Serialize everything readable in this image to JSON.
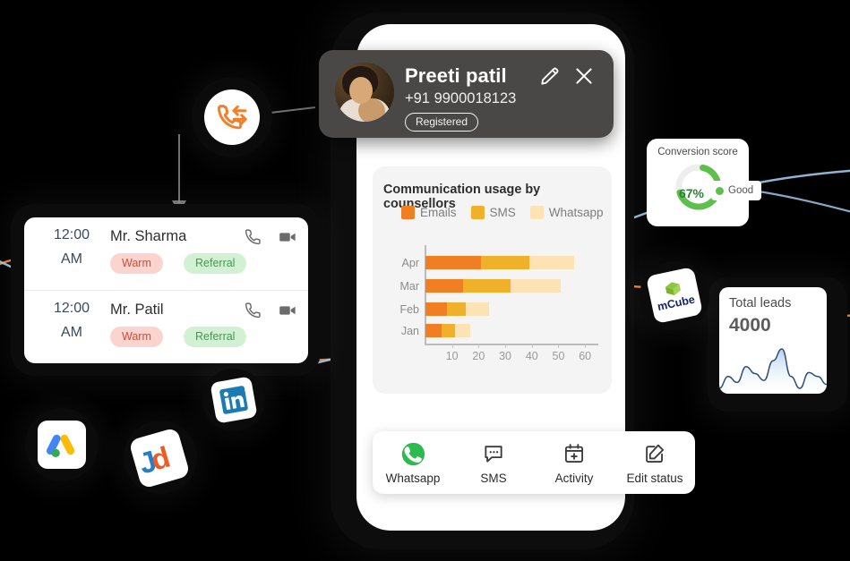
{
  "contact": {
    "name": "Preeti patil",
    "phone": "+91 9900018123",
    "status_badge": "Registered",
    "edit_icon": "pencil-icon",
    "close_icon": "close-icon",
    "avatar": "contact-avatar"
  },
  "chart_card": {
    "title": "Communication usage by counsellors"
  },
  "chart_data": {
    "type": "bar",
    "orientation": "horizontal",
    "stacked": true,
    "title": "Communication usage by counsellors",
    "categories": [
      "Apr",
      "Mar",
      "Feb",
      "Jan"
    ],
    "series": [
      {
        "name": "Emails",
        "color": "#F07F23",
        "values": [
          21,
          14,
          8,
          6
        ]
      },
      {
        "name": "SMS",
        "color": "#F0B02A",
        "values": [
          18,
          18,
          7,
          5
        ]
      },
      {
        "name": "Whatsapp",
        "color": "#FDE3B4",
        "values": [
          17,
          19,
          9,
          6
        ]
      }
    ],
    "totals": [
      56,
      51,
      24,
      17
    ],
    "xlabel": "",
    "ylabel": "",
    "xticks": [
      10,
      20,
      30,
      40,
      50,
      60
    ],
    "xlim": [
      0,
      65
    ],
    "grid": false,
    "legend_position": "top"
  },
  "action_bar": {
    "items": [
      {
        "label": "Whatsapp",
        "icon": "whatsapp-icon"
      },
      {
        "label": "SMS",
        "icon": "message-icon"
      },
      {
        "label": "Activity",
        "icon": "calendar-plus-icon"
      },
      {
        "label": "Edit status",
        "icon": "edit-square-icon"
      }
    ]
  },
  "leads": {
    "rows": [
      {
        "time": "12:00",
        "ampm": "AM",
        "name": "Mr. Sharma",
        "tags": [
          {
            "label": "Warm",
            "type": "warm"
          },
          {
            "label": "Referral",
            "type": "referral"
          }
        ],
        "call_icon": "phone-icon",
        "video_icon": "video-camera-icon"
      },
      {
        "time": "12:00",
        "ampm": "AM",
        "name": "Mr. Patil",
        "tags": [
          {
            "label": "Warm",
            "type": "warm"
          },
          {
            "label": "Referral",
            "type": "referral"
          }
        ],
        "call_icon": "phone-icon",
        "video_icon": "video-camera-icon"
      }
    ]
  },
  "conversion_score": {
    "title": "Conversion score",
    "value": "67%",
    "percent": 67,
    "rating": "Good",
    "color": "#5CC04A"
  },
  "total_leads": {
    "title": "Total leads",
    "value": "4000",
    "sparkline": [
      18,
      30,
      24,
      40,
      33,
      26,
      46,
      58,
      30,
      18,
      34,
      30,
      22
    ]
  },
  "integrations": [
    {
      "name": "call-transfer-badge",
      "icon": "call-transfer-icon",
      "label": ""
    },
    {
      "name": "linkedin-badge",
      "icon": "linkedin-icon",
      "label": "in"
    },
    {
      "name": "justdial-badge",
      "icon": "justdial-icon",
      "label": "Jd"
    },
    {
      "name": "google-ads-badge",
      "icon": "google-ads-icon",
      "label": ""
    },
    {
      "name": "mcube-badge",
      "icon": "mcube-icon",
      "label": "mCube"
    }
  ],
  "colors": {
    "emails": "#F07F23",
    "sms": "#F0B02A",
    "whatsapp": "#FDE3B4",
    "accent_orange": "#F2802A",
    "accent_blue": "#9FC6E8",
    "green": "#5CC04A",
    "card_dark": "#4A4846"
  }
}
